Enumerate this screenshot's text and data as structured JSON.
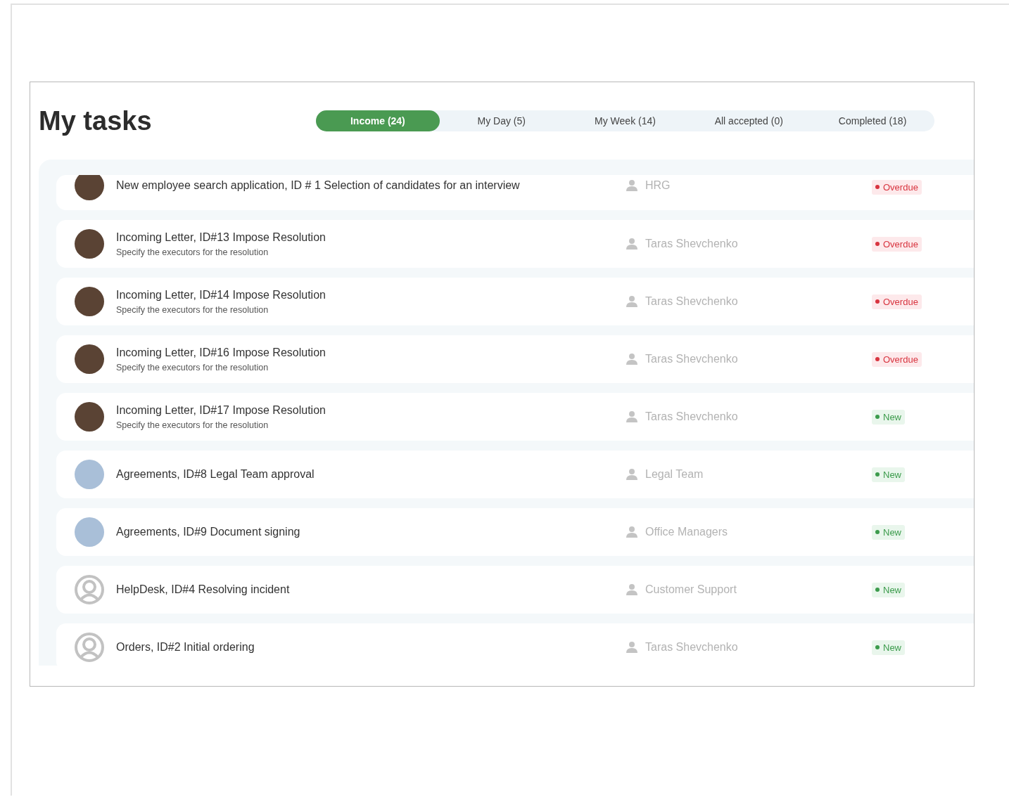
{
  "title": "My tasks",
  "tabs": [
    {
      "label": "Income (24)",
      "selected": true
    },
    {
      "label": "My Day  (5)",
      "selected": false
    },
    {
      "label": "My Week (14)",
      "selected": false
    },
    {
      "label": "All accepted (0)",
      "selected": false
    },
    {
      "label": "Completed (18)",
      "selected": false
    }
  ],
  "tasks": [
    {
      "kind": "dark",
      "title": "New employee search application, ID # 1 Selection of candidates for an interview",
      "assignee": "HRG",
      "status": {
        "kind": "overdue",
        "label": "Overdue"
      }
    },
    {
      "kind": "dark",
      "title": "Incoming Letter, ID#13 Impose Resolution",
      "subtitle": "Specify the executors for the resolution",
      "assignee": "Taras Shevchenko",
      "status": {
        "kind": "overdue",
        "label": "Overdue"
      }
    },
    {
      "kind": "dark",
      "title": "Incoming Letter, ID#14 Impose Resolution",
      "subtitle": "Specify the executors for the resolution",
      "assignee": "Taras Shevchenko",
      "status": {
        "kind": "overdue",
        "label": "Overdue"
      }
    },
    {
      "kind": "dark",
      "title": "Incoming Letter, ID#16 Impose Resolution",
      "subtitle": "Specify the executors for the resolution",
      "assignee": "Taras Shevchenko",
      "status": {
        "kind": "overdue",
        "label": "Overdue"
      }
    },
    {
      "kind": "dark",
      "title": "Incoming Letter, ID#17 Impose Resolution",
      "subtitle": "Specify the executors for the resolution",
      "assignee": "Taras Shevchenko",
      "status": {
        "kind": "new",
        "label": "New"
      }
    },
    {
      "kind": "light",
      "title": "Agreements, ID#8 Legal Team approval",
      "assignee": "Legal Team",
      "status": {
        "kind": "new",
        "label": "New"
      }
    },
    {
      "kind": "light",
      "title": "Agreements, ID#9 Document signing",
      "assignee": "Office Managers",
      "status": {
        "kind": "new",
        "label": "New"
      }
    },
    {
      "kind": "default",
      "title": "HelpDesk, ID#4 Resolving incident",
      "assignee": "Customer Support",
      "status": {
        "kind": "new",
        "label": "New"
      }
    },
    {
      "kind": "default",
      "title": "Orders, ID#2 Initial ordering",
      "assignee": "Taras Shevchenko",
      "status": {
        "kind": "new",
        "label": "New"
      }
    }
  ]
}
